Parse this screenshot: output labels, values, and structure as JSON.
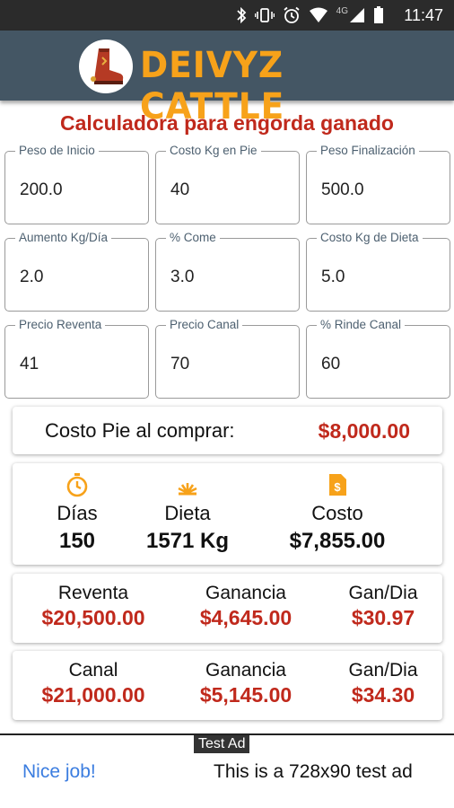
{
  "status_bar": {
    "network": "4G",
    "time": "11:47"
  },
  "app_bar": {
    "brand": "DEIVYZ CATTLE",
    "brand_color": "#f7a21a",
    "bg_color": "#445664"
  },
  "title": "Calculadora para engorda ganado",
  "fields": [
    {
      "label": "Peso de Inicio",
      "value": "200.0"
    },
    {
      "label": "Costo Kg en Pie",
      "value": "40"
    },
    {
      "label": "Peso Finalización",
      "value": "500.0"
    },
    {
      "label": "Aumento Kg/Día",
      "value": "2.0"
    },
    {
      "label": "% Come",
      "value": "3.0"
    },
    {
      "label": "Costo Kg de Dieta",
      "value": "5.0"
    },
    {
      "label": "Precio Reventa",
      "value": "41"
    },
    {
      "label": "Precio Canal",
      "value": "70"
    },
    {
      "label": "% Rinde Canal",
      "value": "60"
    }
  ],
  "purchase": {
    "label": "Costo Pie al comprar:",
    "value": "$8,000.00"
  },
  "summary": {
    "dias_label": "Días",
    "dias_value": "150",
    "dieta_label": "Dieta",
    "dieta_value": "1571 Kg",
    "costo_label": "Costo",
    "costo_value": "$7,855.00",
    "icon_color": "#f7a21a"
  },
  "resale": {
    "reventa_label": "Reventa",
    "reventa_value": "$20,500.00",
    "ganancia_label": "Ganancia",
    "ganancia_value": "$4,645.00",
    "gandia_label": "Gan/Dia",
    "gandia_value": "$30.97"
  },
  "canal": {
    "canal_label": "Canal",
    "canal_value": "$21,000.00",
    "ganancia_label": "Ganancia",
    "ganancia_value": "$5,145.00",
    "gandia_label": "Gan/Dia",
    "gandia_value": "$34.30"
  },
  "ad": {
    "tag": "Test Ad",
    "nice": "Nice job!",
    "text": "This is a 728x90 test ad"
  },
  "accent_color": "#c0291c"
}
